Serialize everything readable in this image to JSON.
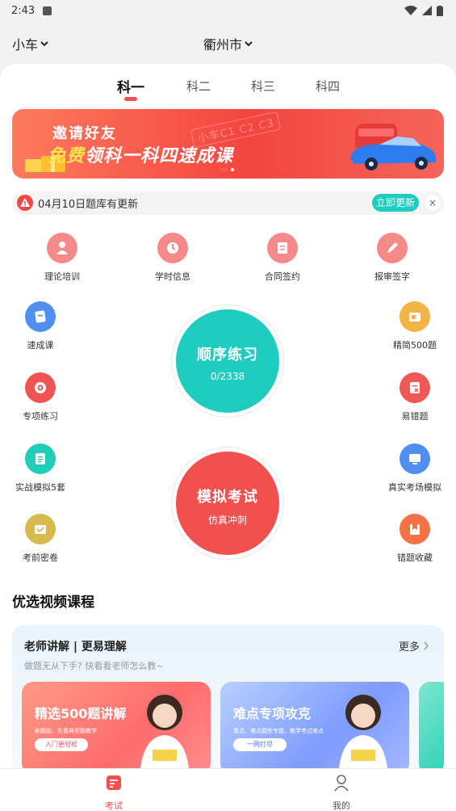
{
  "status_bar": {
    "time": "2:43"
  },
  "header": {
    "vehicle": "小车",
    "city": "衢州市"
  },
  "tabs": [
    {
      "label": "科一",
      "active": true
    },
    {
      "label": "科二",
      "active": false
    },
    {
      "label": "科三",
      "active": false
    },
    {
      "label": "科四",
      "active": false
    }
  ],
  "banner": {
    "title": "邀请好友",
    "subtitle_highlight": "免费",
    "subtitle_rest": "领科一科四速成课",
    "tag": "小车C1 C2 C3"
  },
  "notice": {
    "text": "04月10日题库有更新",
    "button": "立即更新",
    "close": "×"
  },
  "top_features": [
    {
      "label": "理论培训",
      "icon": "student-icon",
      "color": "#f48a8a"
    },
    {
      "label": "学时信息",
      "icon": "clock-icon",
      "color": "#f48a8a"
    },
    {
      "label": "合同签约",
      "icon": "contract-icon",
      "color": "#f48a8a"
    },
    {
      "label": "报审签字",
      "icon": "pen-icon",
      "color": "#f48a8a"
    }
  ],
  "left_features": [
    {
      "label": "速成课",
      "icon": "book-icon",
      "color": "#4f8ff0"
    },
    {
      "label": "专项练习",
      "icon": "target-icon",
      "color": "#f05353"
    },
    {
      "label": "实战模拟5套",
      "icon": "document-icon",
      "color": "#22cdb8"
    },
    {
      "label": "考前密卷",
      "icon": "envelope-icon",
      "color": "#d6ba4e"
    }
  ],
  "right_features": [
    {
      "label": "精简500题",
      "icon": "card-icon",
      "color": "#f3b346"
    },
    {
      "label": "易错题",
      "icon": "error-book-icon",
      "color": "#f05757"
    },
    {
      "label": "真实考场模拟",
      "icon": "monitor-icon",
      "color": "#4f8ff0"
    },
    {
      "label": "错题收藏",
      "icon": "bookmark-icon",
      "color": "#f27446"
    }
  ],
  "practice": {
    "title": "顺序练习",
    "progress": "0/2338",
    "color": "#1fcdc0"
  },
  "exam": {
    "title": "模拟考试",
    "subtitle": "仿真冲刺",
    "color": "#f24f4f"
  },
  "video_section": {
    "title": "优选视频课程",
    "panel_title": "老师讲解 | 更易理解",
    "more": "更多",
    "subtitle": "做题无从下手? 快看看老师怎么教~",
    "cards": [
      {
        "title": "精选500题讲解",
        "desc": "刷题前，先看典型题教学",
        "button": "入门更轻松"
      },
      {
        "title": "难点专项攻克",
        "desc": "重点、难点题型专题，教学考试难点",
        "button": "一网打尽"
      }
    ]
  },
  "bottom_nav": [
    {
      "label": "考试",
      "icon": "exam-icon",
      "active": true
    },
    {
      "label": "我的",
      "icon": "user-icon",
      "active": false
    }
  ]
}
